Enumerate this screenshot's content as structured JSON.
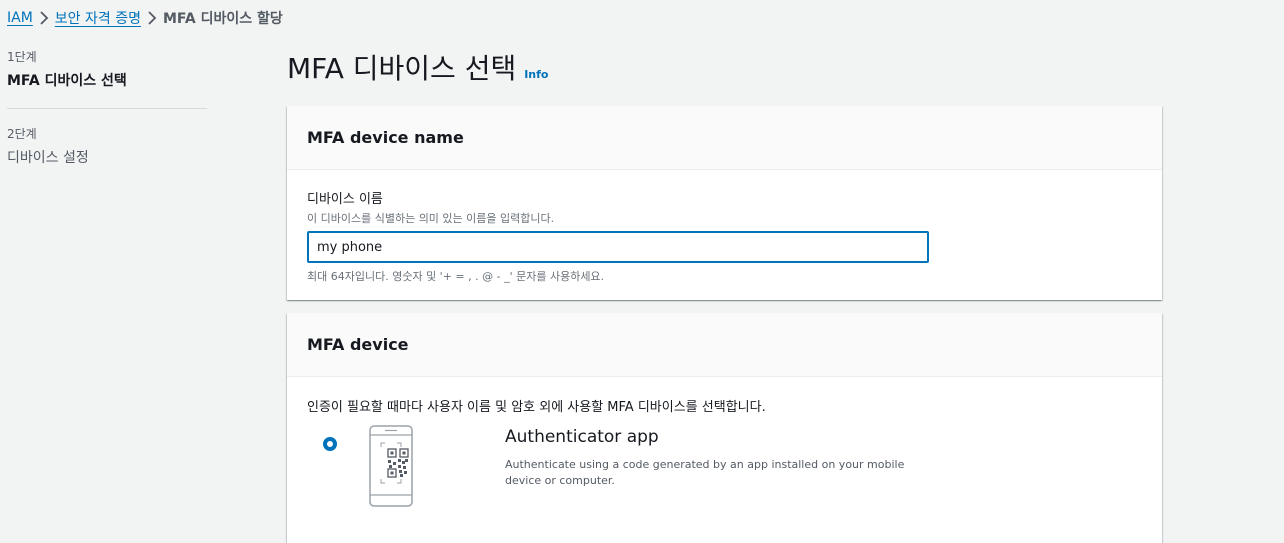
{
  "breadcrumb": {
    "items": [
      "IAM",
      "보안 자격 증명"
    ],
    "current": "MFA 디바이스 할당"
  },
  "steps": [
    {
      "num": "1단계",
      "title": "MFA 디바이스 선택"
    },
    {
      "num": "2단계",
      "title": "디바이스 설정"
    }
  ],
  "page": {
    "title": "MFA 디바이스 선택",
    "info": "Info"
  },
  "device_name_card": {
    "header": "MFA device name",
    "label": "디바이스 이름",
    "description": "이 디바이스를 식별하는 의미 있는 이름을 입력합니다.",
    "value": "my phone",
    "constraint": "최대 64자입니다. 영숫자 및 '+ = , . @ - _' 문자를 사용하세요."
  },
  "device_card": {
    "header": "MFA device",
    "description": "인증이 필요할 때마다 사용자 이름 및 암호 외에 사용할 MFA 디바이스를 선택합니다.",
    "options": [
      {
        "title": "Authenticator app",
        "description": "Authenticate using a code generated by an app installed on your mobile device or computer.",
        "icon": "phone-qr-icon",
        "selected": true
      }
    ]
  },
  "colors": {
    "accent": "#0073bb",
    "background": "#f2f3f3"
  }
}
